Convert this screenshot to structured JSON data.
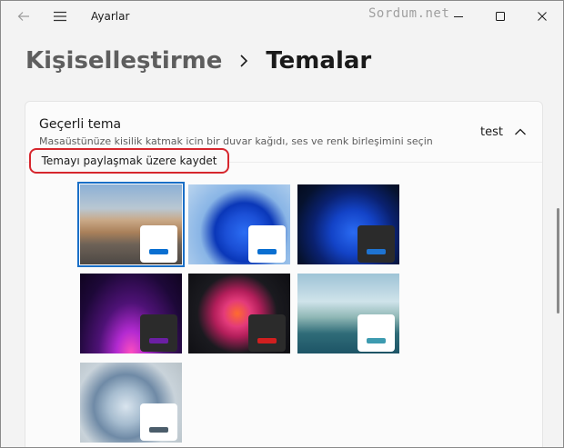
{
  "app": {
    "title": "Ayarlar",
    "watermark": "Sordum.net"
  },
  "breadcrumb": {
    "parent": "Kişiselleştirme",
    "current": "Temalar"
  },
  "current_theme": {
    "title": "Geçerli tema",
    "description": "Masaüstünüze kisilik katmak icin bir duvar kağıdı, ses ve renk birleşimini seçin",
    "value": "test"
  },
  "tooltip": {
    "text": "Temayı paylaşmak üzere kaydet"
  },
  "themes": [
    {
      "name": "desert-road",
      "selected": true,
      "mini_bg": "#ffffff",
      "accent": "#0a6fd1"
    },
    {
      "name": "windows-light-bloom",
      "selected": false,
      "mini_bg": "#ffffff",
      "accent": "#0a6fd1"
    },
    {
      "name": "windows-dark-bloom",
      "selected": false,
      "mini_bg": "#2b2b2b",
      "accent": "#1e73d1"
    },
    {
      "name": "glow",
      "selected": false,
      "mini_bg": "#2b2b2b",
      "accent": "#6b1fa3"
    },
    {
      "name": "captured-motion",
      "selected": false,
      "mini_bg": "#2b2b2b",
      "accent": "#d11f1f"
    },
    {
      "name": "sunrise-lake",
      "selected": false,
      "mini_bg": "#ffffff",
      "accent": "#3d9bb0"
    },
    {
      "name": "flow",
      "selected": false,
      "mini_bg": "#ffffff",
      "accent": "#4b5d6b"
    }
  ],
  "icons": [
    "back-arrow-icon",
    "hamburger-menu-icon",
    "minimize-icon",
    "maximize-icon",
    "close-icon",
    "chevron-right-icon",
    "chevron-up-icon"
  ]
}
